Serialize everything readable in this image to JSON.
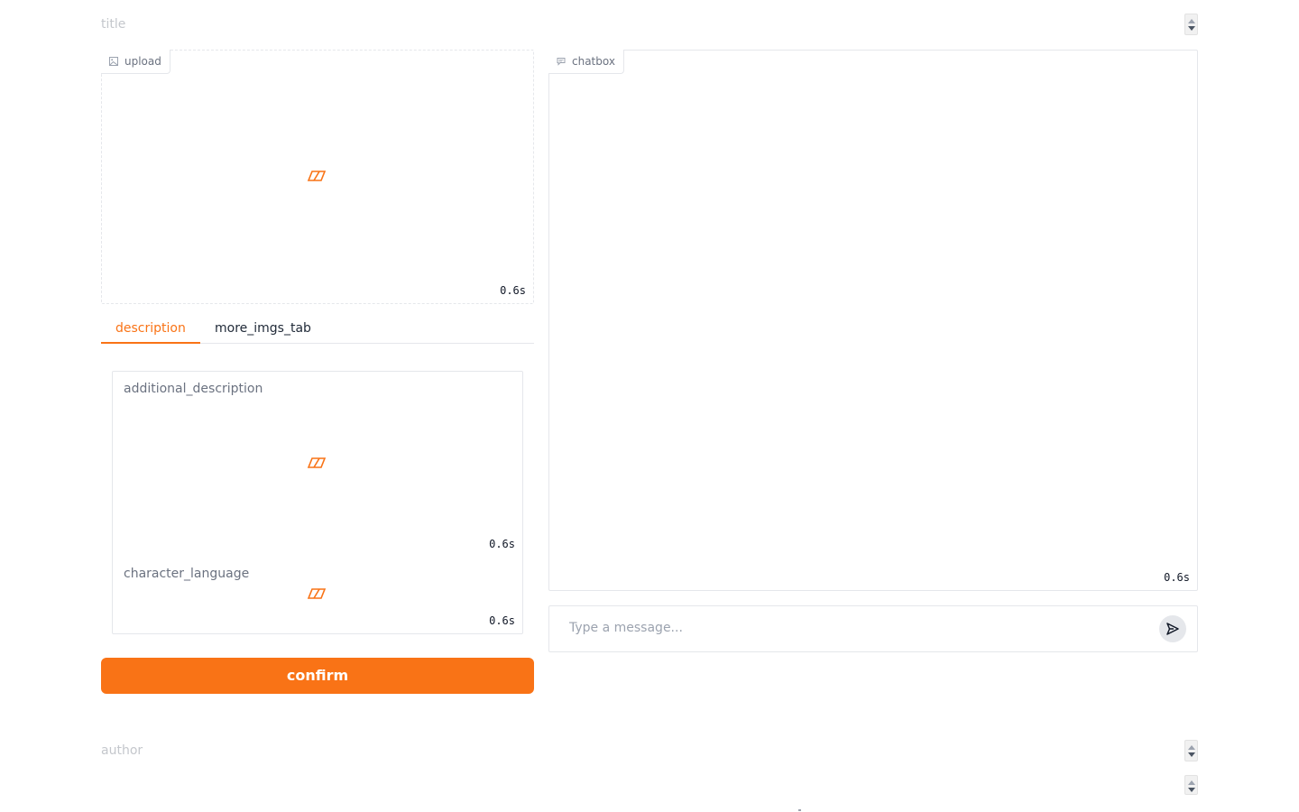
{
  "title_field": {
    "placeholder": "title"
  },
  "upload": {
    "label": "upload",
    "icon": "image-icon",
    "timer": "0.6s"
  },
  "tabs": [
    {
      "label": "description",
      "active": true
    },
    {
      "label": "more_imgs_tab",
      "active": false
    }
  ],
  "description": {
    "additional_description": {
      "label": "additional_description",
      "timer": "0.6s"
    },
    "character_language": {
      "label": "character_language",
      "timer": "0.6s"
    }
  },
  "confirm_label": "confirm",
  "chatbox": {
    "label": "chatbox",
    "icon": "chat-icon",
    "timer": "0.6s",
    "message_placeholder": "Type a message..."
  },
  "author_field": {
    "placeholder": "author"
  },
  "colors": {
    "accent": "#f97316",
    "border": "#e5e7eb",
    "placeholder": "#c4c7cc"
  }
}
